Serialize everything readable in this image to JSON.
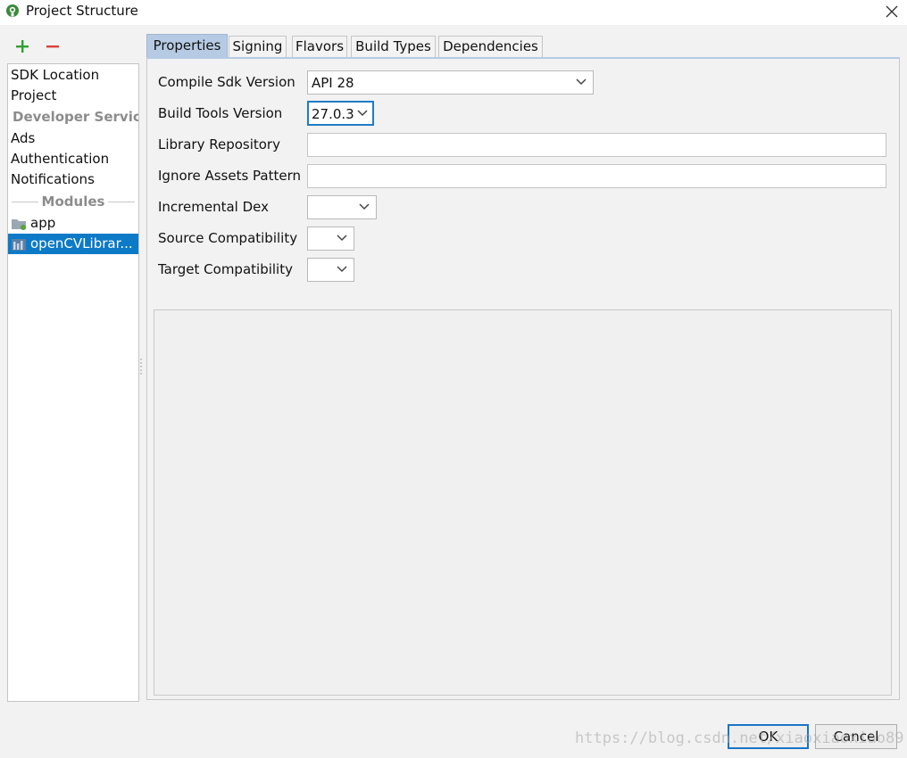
{
  "window": {
    "title": "Project Structure",
    "close_glyph": "✕"
  },
  "toolbar": {
    "add_icon": "plus-icon",
    "remove_icon": "minus-icon",
    "add_color": "#2fa02f",
    "remove_color": "#d9413a"
  },
  "sidebar": {
    "items": [
      {
        "label": "SDK Location"
      },
      {
        "label": "Project"
      },
      {
        "label": "Developer Servic..."
      },
      {
        "label": "Ads"
      },
      {
        "label": "Authentication"
      },
      {
        "label": "Notifications"
      }
    ],
    "modules_header": "Modules",
    "modules": [
      {
        "label": "app",
        "icon": "folder-module-icon"
      },
      {
        "label": "openCVLibrar...",
        "icon": "library-module-icon",
        "selected": true
      }
    ],
    "selected_color": "#0c7ac7"
  },
  "tabs": [
    {
      "label": "Properties",
      "active": true
    },
    {
      "label": "Signing"
    },
    {
      "label": "Flavors"
    },
    {
      "label": "Build Types"
    },
    {
      "label": "Dependencies"
    }
  ],
  "properties": {
    "compile_sdk": {
      "label": "Compile Sdk Version",
      "value": "API 28"
    },
    "build_tools": {
      "label": "Build Tools Version",
      "value": "27.0.3"
    },
    "library_repo": {
      "label": "Library Repository",
      "value": ""
    },
    "ignore_assets": {
      "label": "Ignore Assets Pattern",
      "value": ""
    },
    "incremental_dex": {
      "label": "Incremental Dex",
      "value": ""
    },
    "source_compat": {
      "label": "Source Compatibility",
      "value": ""
    },
    "target_compat": {
      "label": "Target Compatibility",
      "value": ""
    }
  },
  "buttons": {
    "ok": "OK",
    "cancel": "Cancel"
  },
  "watermark": "https://blog.csdn.net/xiaoxiaoxiao89"
}
